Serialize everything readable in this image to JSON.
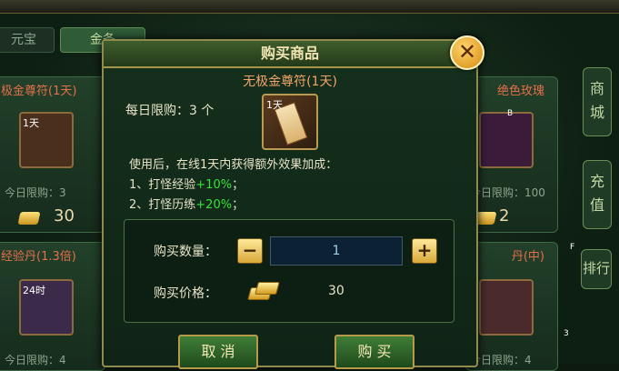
{
  "tabs": {
    "yuanbao": "元宝",
    "gold": "金条"
  },
  "side_tabs": [
    "商城",
    "充值",
    "排行"
  ],
  "shop_cards": [
    {
      "title": "极金尊符(1天)",
      "badge": "1天",
      "limit": "今日限购：3",
      "price": "30"
    },
    {
      "title": "绝色玫瑰",
      "limit": "今日限购：100",
      "price": "2"
    },
    {
      "title": "经验丹(1.3倍)",
      "badge": "24时",
      "limit": "今日限购：4"
    },
    {
      "title": "丹(中)",
      "limit": "今日限购：4"
    }
  ],
  "stray_marks": [
    "B",
    "F",
    "3"
  ],
  "dialog": {
    "title": "购买商品",
    "close_label": "✕",
    "item_name": "无极金尊符(1天)",
    "daily_limit": "每日限购：3 个",
    "item_badge": "1天",
    "desc_intro": "使用后，在线1天内获得额外效果加成：",
    "desc_lines": [
      {
        "prefix": "1、打怪经验",
        "bonus": "+10%",
        "suffix": "；"
      },
      {
        "prefix": "2、打怪历练",
        "bonus": "+20%",
        "suffix": "；"
      }
    ],
    "qty_label": "购买数量：",
    "qty_value": "1",
    "minus_label": "−",
    "plus_label": "+",
    "price_label": "购买价格：",
    "price_value": "30",
    "cancel_label": "取 消",
    "buy_label": "购 买"
  }
}
